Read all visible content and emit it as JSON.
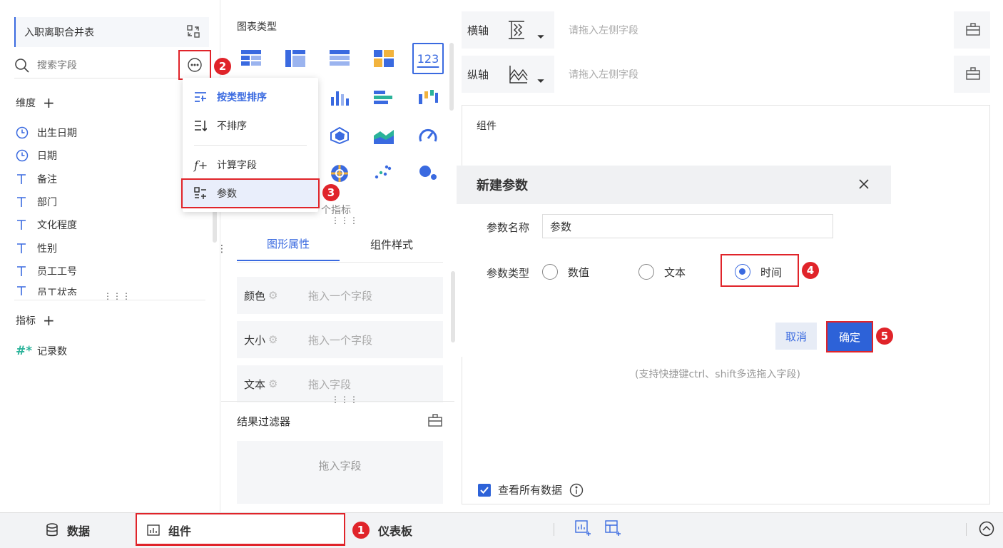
{
  "left": {
    "dataset_name": "入职离职合并表",
    "search_placeholder": "搜索字段",
    "dimensions_title": "维度",
    "dimensions": [
      {
        "label": "出生日期",
        "icon": "clock-icon"
      },
      {
        "label": "日期",
        "icon": "clock-icon"
      },
      {
        "label": "备注",
        "icon": "text-t-icon"
      },
      {
        "label": "部门",
        "icon": "text-t-icon"
      },
      {
        "label": "文化程度",
        "icon": "text-t-icon"
      },
      {
        "label": "性别",
        "icon": "text-t-icon"
      },
      {
        "label": "员工工号",
        "icon": "text-t-icon"
      },
      {
        "label": "员工状态",
        "icon": "text-t-icon"
      }
    ],
    "measures_title": "指标",
    "measures": [
      {
        "label": "记录数",
        "icon": "hash-icon"
      }
    ]
  },
  "menu": {
    "items": [
      {
        "label": "按类型排序",
        "icon": "sort-by-type-icon"
      },
      {
        "label": "不排序",
        "icon": "no-sort-icon"
      },
      {
        "label": "计算字段",
        "icon": "formula-icon"
      },
      {
        "label": "参数",
        "icon": "parameter-icon"
      }
    ]
  },
  "mid": {
    "chart_type_title": "图表类型",
    "selected_chart_label": "123",
    "hint_text": "个指标",
    "tabs": [
      "图形属性",
      "组件样式"
    ],
    "props": [
      {
        "label": "颜色",
        "hint": "拖入一个字段"
      },
      {
        "label": "大小",
        "hint": "拖入一个字段"
      },
      {
        "label": "文本",
        "hint": "拖入字段"
      }
    ],
    "filter_title": "结果过滤器",
    "filter_hint": "拖入字段"
  },
  "right": {
    "x_axis_label": "横轴",
    "y_axis_label": "纵轴",
    "axis_placeholder": "请拖入左侧字段",
    "canvas_title": "组件",
    "shortcut_hint": "(支持快捷键ctrl、shift多选拖入字段)",
    "view_all_label": "查看所有数据"
  },
  "dialog": {
    "title": "新建参数",
    "name_label": "参数名称",
    "name_value": "参数",
    "type_label": "参数类型",
    "types": [
      "数值",
      "文本",
      "时间"
    ],
    "selected_type": "时间",
    "cancel": "取消",
    "ok": "确定"
  },
  "bottom": {
    "data_tab": "数据",
    "component_tab": "组件",
    "dashboard_tab": "仪表板"
  },
  "badges": [
    "1",
    "2",
    "3",
    "4",
    "5"
  ],
  "colors": {
    "accent": "#3a6ae0",
    "highlight": "#e0242a",
    "teal": "#2bb39a"
  }
}
